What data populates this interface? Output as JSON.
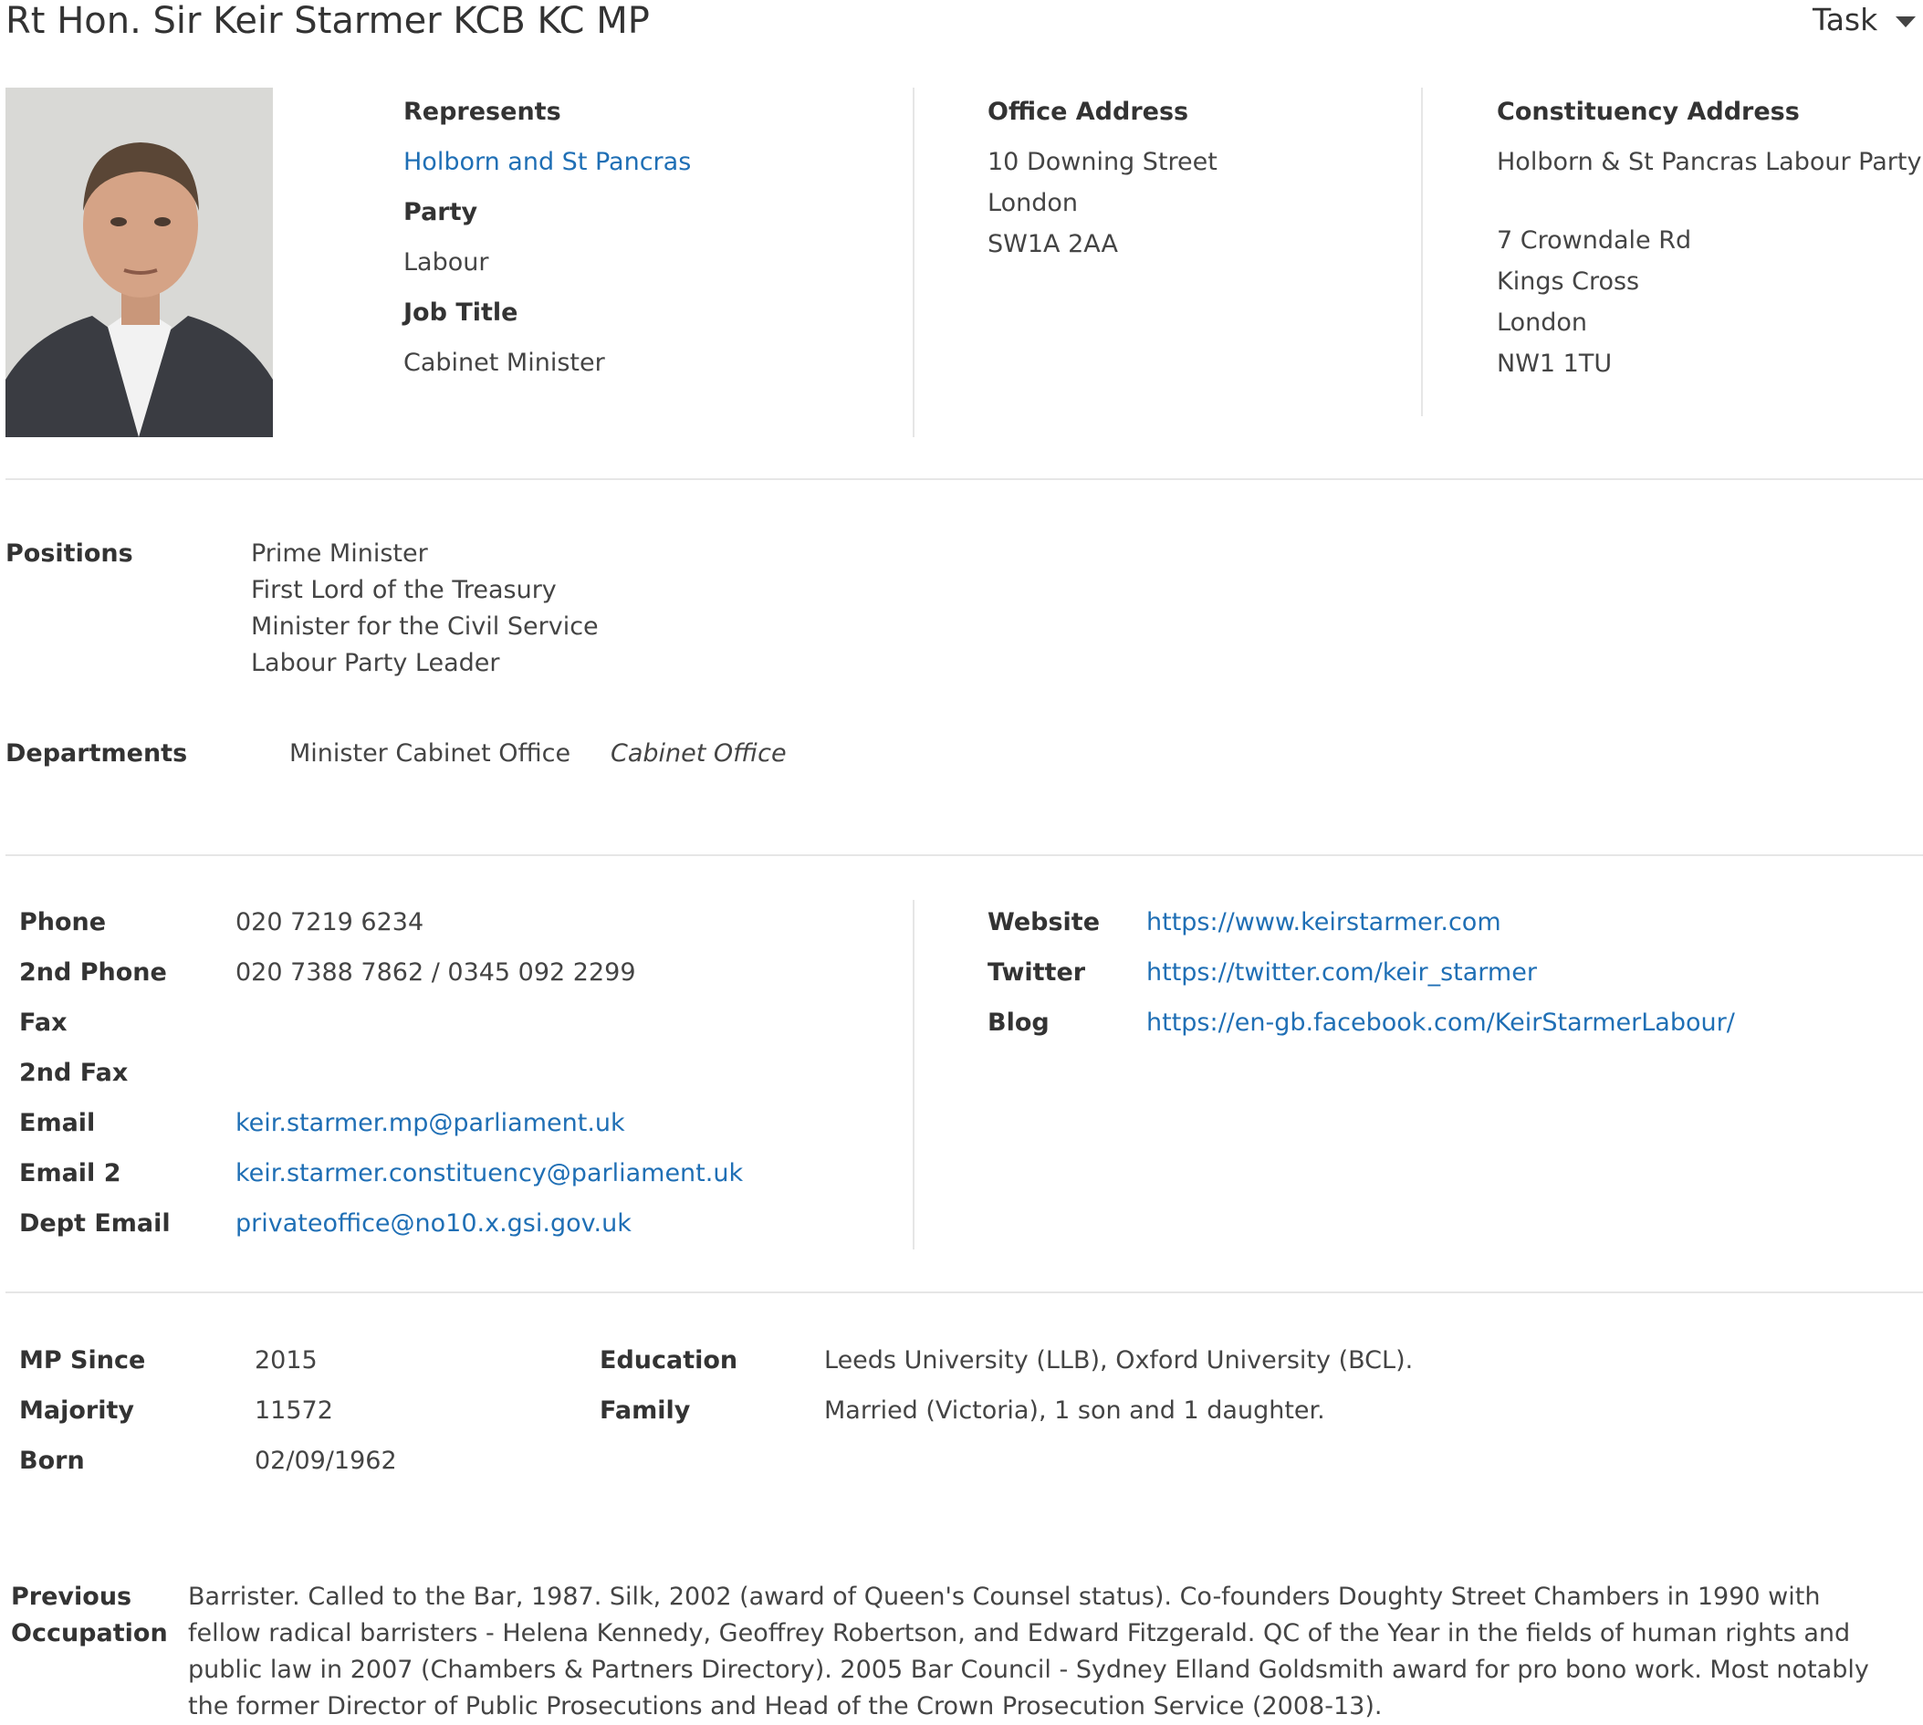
{
  "header": {
    "title": "Rt Hon. Sir Keir Starmer KCB KC MP",
    "task_label": "Task"
  },
  "profile": {
    "represents_label": "Represents",
    "represents": "Holborn and St Pancras",
    "party_label": "Party",
    "party": "Labour",
    "job_title_label": "Job Title",
    "job_title": "Cabinet Minister"
  },
  "office_address": {
    "label": "Office Address",
    "lines": [
      "10 Downing Street",
      "London",
      "SW1A 2AA"
    ]
  },
  "constituency_address": {
    "label": "Constituency Address",
    "lines": [
      "Holborn & St Pancras Labour Party",
      "7 Crowndale Rd",
      "Kings Cross",
      "London",
      "NW1 1TU"
    ]
  },
  "positions": {
    "label": "Positions",
    "items": [
      "Prime Minister",
      "First Lord of the Treasury",
      "Minister for the Civil Service",
      "Labour Party Leader"
    ]
  },
  "departments": {
    "label": "Departments",
    "role": "Minister Cabinet Office",
    "department": "Cabinet Office"
  },
  "contact": {
    "phone_label": "Phone",
    "phone": "020 7219 6234",
    "phone2_label": "2nd Phone",
    "phone2": "020 7388 7862 / 0345 092 2299",
    "fax_label": "Fax",
    "fax2_label": "2nd Fax",
    "email_label": "Email",
    "email": "keir.starmer.mp@parliament.uk",
    "email2_label": "Email 2",
    "email2": "keir.starmer.constituency@parliament.uk",
    "dept_email_label": "Dept Email",
    "dept_email": "privateoffice@no10.x.gsi.gov.uk"
  },
  "online": {
    "website_label": "Website",
    "website": "https://www.keirstarmer.com",
    "twitter_label": "Twitter",
    "twitter": "https://twitter.com/keir_starmer",
    "blog_label": "Blog",
    "blog": "https://en-gb.facebook.com/KeirStarmerLabour/"
  },
  "details": {
    "mp_since_label": "MP Since",
    "mp_since": "2015",
    "majority_label": "Majority",
    "majority": "11572",
    "born_label": "Born",
    "born": "02/09/1962",
    "education_label": "Education",
    "education": "Leeds University (LLB), Oxford University (BCL).",
    "family_label": "Family",
    "family": "Married (Victoria), 1 son and 1 daughter."
  },
  "previous_occupation": {
    "label_line1": "Previous",
    "label_line2": "Occupation",
    "text": "Barrister. Called to the Bar, 1987. Silk, 2002 (award of Queen's Counsel status). Co-founders Doughty Street Chambers in 1990 with fellow radical barristers - Helena Kennedy, Geoffrey Robertson, and Edward Fitzgerald. QC of the Year in the fields of human rights and public law in 2007 (Chambers & Partners Directory). 2005 Bar Council - Sydney Elland Goldsmith award for pro bono work. Most notably the former Director of Public Prosecutions and Head of the Crown Prosecution Service (2008-13)."
  },
  "colors": {
    "link": "#1f6fb5",
    "text": "#333333",
    "divider": "#e6e6e6"
  }
}
